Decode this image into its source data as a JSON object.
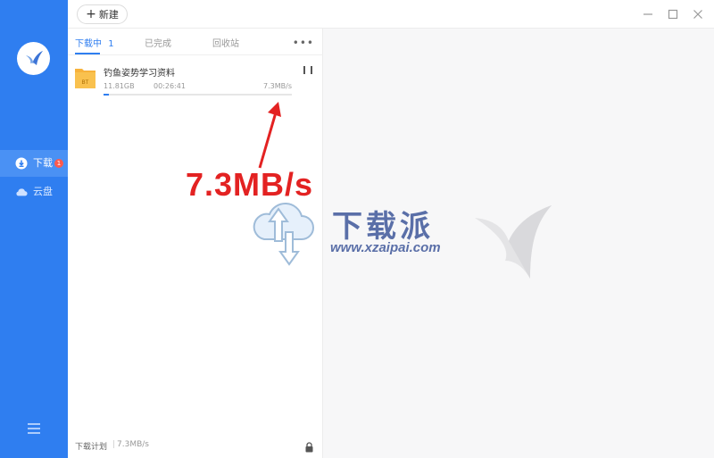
{
  "sidebar": {
    "items": [
      {
        "label": "下载",
        "badge": "1",
        "icon": "download-icon"
      },
      {
        "label": "云盘",
        "icon": "cloud-icon"
      }
    ],
    "menu_icon": "hamburger-menu-icon",
    "logo_icon": "bird-logo-icon"
  },
  "toolbar": {
    "new_label": "新建",
    "window_controls": [
      "minimize-icon",
      "maximize-icon",
      "close-icon"
    ]
  },
  "tabs": [
    {
      "label": "下载中",
      "count": "1"
    },
    {
      "label": "已完成"
    },
    {
      "label": "回收站"
    }
  ],
  "more_label": "•••",
  "task": {
    "name": "钓鱼姿势学习资料",
    "size": "11.81GB",
    "remaining": "00:26:41",
    "speed": "7.3MB/s",
    "progress": 0.03,
    "file_badge": "BT"
  },
  "footer": {
    "plan_label": "下载计划",
    "separator": "|",
    "speed": "7.3MB/s"
  },
  "annotation": {
    "text": "7.3MB/s"
  },
  "watermark": {
    "title": "下载派",
    "url": "www.xzaipai.com"
  },
  "colors": {
    "sidebar": "#2f7ef0",
    "accent": "#2f7ef0",
    "badge": "#ff5a4d",
    "annotation": "#e32222",
    "folder": "#f7b23b"
  }
}
